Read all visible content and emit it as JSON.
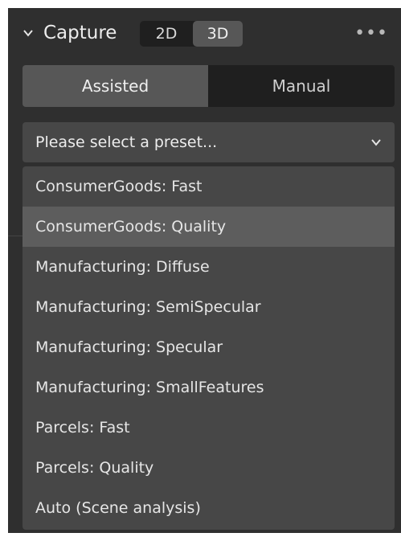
{
  "header": {
    "title": "Capture",
    "mode_2d": "2D",
    "mode_3d": "3D",
    "more_glyph": "•••"
  },
  "tabs": {
    "assisted": "Assisted",
    "manual": "Manual"
  },
  "preset": {
    "placeholder": "Please select a preset...",
    "options": [
      "ConsumerGoods: Fast",
      "ConsumerGoods: Quality",
      "Manufacturing: Diffuse",
      "Manufacturing: SemiSpecular",
      "Manufacturing: Specular",
      "Manufacturing: SmallFeatures",
      "Parcels: Fast",
      "Parcels: Quality",
      "Auto (Scene analysis)"
    ],
    "highlighted_index": 1
  },
  "colors": {
    "panel": "#2f2f2f",
    "active": "#575757",
    "inactive": "#1f1f1f",
    "dropdown": "#474747",
    "highlight": "#5d5d5d"
  }
}
